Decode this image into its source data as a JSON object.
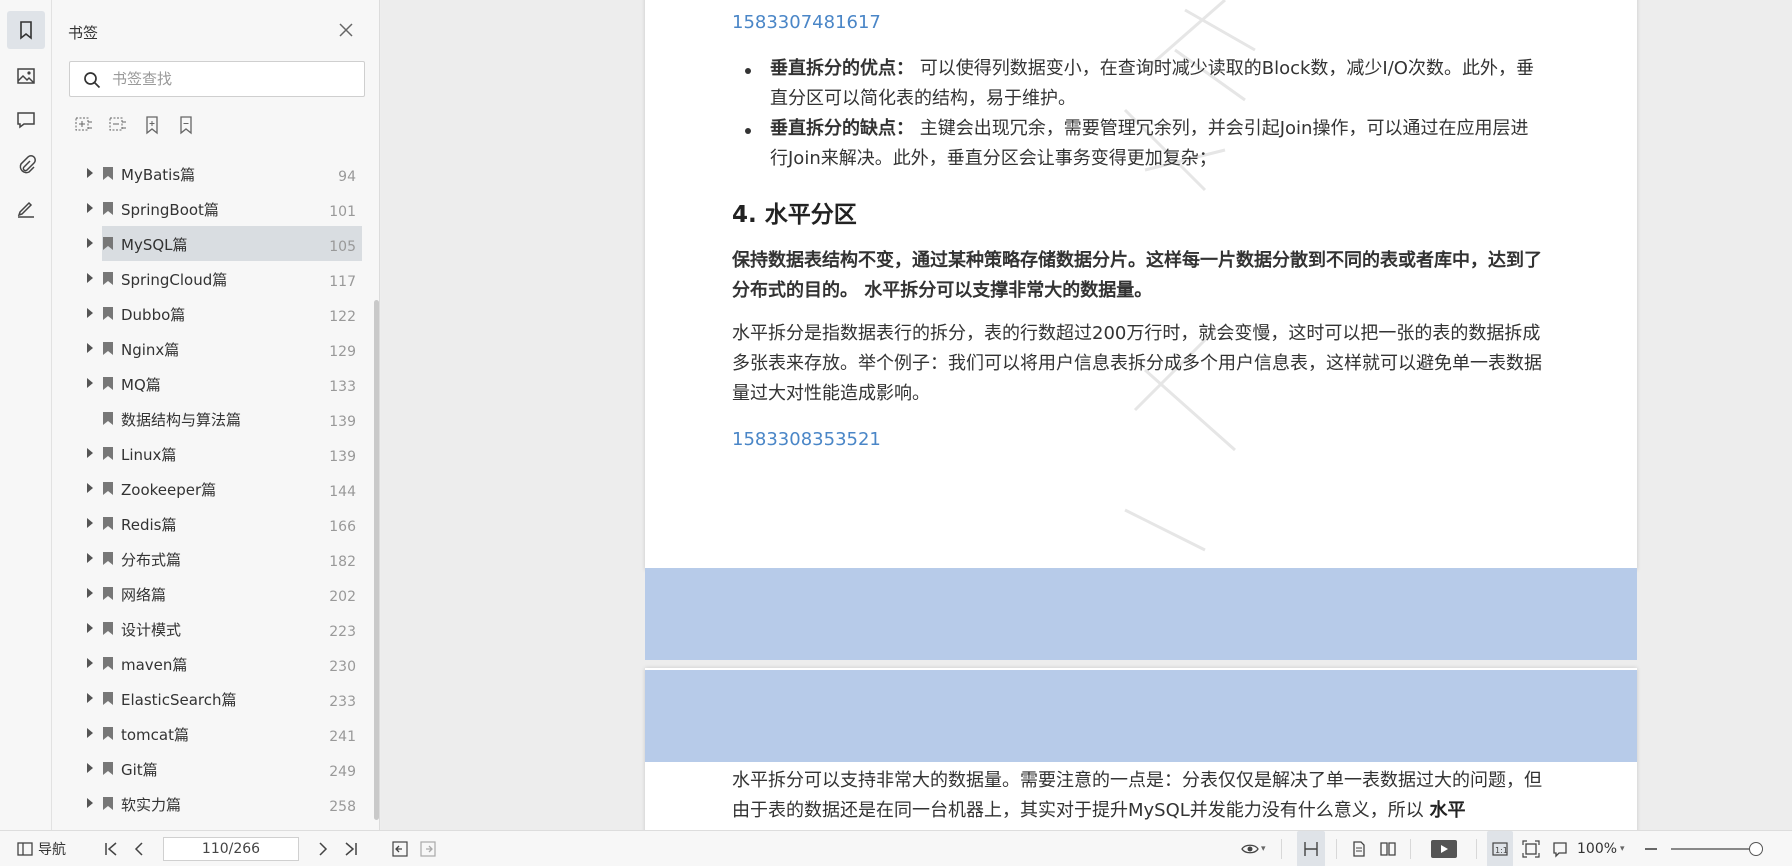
{
  "rail": {
    "icons": [
      "bookmark-icon",
      "image-icon",
      "comment-icon",
      "attachment-icon",
      "signature-icon"
    ]
  },
  "panel": {
    "title": "书签",
    "search_placeholder": "书签查找",
    "items": [
      {
        "label": "MyBatis篇",
        "page": "94",
        "expandable": true
      },
      {
        "label": "SpringBoot篇",
        "page": "101",
        "expandable": true
      },
      {
        "label": "MySQL篇",
        "page": "105",
        "expandable": true,
        "selected": true
      },
      {
        "label": "SpringCloud篇",
        "page": "117",
        "expandable": true
      },
      {
        "label": "Dubbo篇",
        "page": "122",
        "expandable": true
      },
      {
        "label": "Nginx篇",
        "page": "129",
        "expandable": true
      },
      {
        "label": "MQ篇",
        "page": "133",
        "expandable": true
      },
      {
        "label": "数据结构与算法篇",
        "page": "139",
        "expandable": false
      },
      {
        "label": "Linux篇",
        "page": "139",
        "expandable": true
      },
      {
        "label": "Zookeeper篇",
        "page": "144",
        "expandable": true
      },
      {
        "label": "Redis篇",
        "page": "166",
        "expandable": true
      },
      {
        "label": "分布式篇",
        "page": "182",
        "expandable": true
      },
      {
        "label": "网络篇",
        "page": "202",
        "expandable": true
      },
      {
        "label": "设计模式",
        "page": "223",
        "expandable": true
      },
      {
        "label": "maven篇",
        "page": "230",
        "expandable": true
      },
      {
        "label": "ElasticSearch篇",
        "page": "233",
        "expandable": true
      },
      {
        "label": "tomcat篇",
        "page": "241",
        "expandable": true
      },
      {
        "label": "Git篇",
        "page": "249",
        "expandable": true
      },
      {
        "label": "软实力篇",
        "page": "258",
        "expandable": true
      }
    ]
  },
  "doc": {
    "link1": "1583307481617",
    "bullet1_bold": "垂直拆分的优点：",
    "bullet1_text": "可以使得列数据变小，在查询时减少读取的Block数，减少I/O次数。此外，垂直分区可以简化表的结构，易于维护。",
    "bullet2_bold": "垂直拆分的缺点：",
    "bullet2_text": "主键会出现冗余，需要管理冗余列，并会引起Join操作，可以通过在应用层进行Join来解决。此外，垂直分区会让事务变得更加复杂；",
    "heading": "4. 水平分区",
    "bold_para": "保持数据表结构不变，通过某种策略存储数据分片。这样每一片数据分散到不同的表或者库中，达到了分布式的目的。 水平拆分可以支撑非常大的数据量。",
    "para": "水平拆分是指数据表行的拆分，表的行数超过200万行时，就会变慢，这时可以把一张的表的数据拆成多张表来存放。举个例子：我们可以将用户信息表拆分成多个用户信息表，这样就可以避免单一表数据量过大对性能造成影响。",
    "link2": "1583308353521",
    "page2_text": "水平拆分可以支持非常大的数据量。需要注意的一点是：分表仅仅是解决了单一表数据过大的问题，但由于表的数据还是在同一台机器上，其实对于提升MySQL并发能力没有什么意义，所以",
    "page2_bold": "水平"
  },
  "statusbar": {
    "nav_label": "导航",
    "page_indicator": "110/266",
    "zoom": "100%"
  },
  "colors": {
    "link": "#4a86c7",
    "selection_band": "#b7cbe9",
    "selected_item": "#d9dde1"
  }
}
